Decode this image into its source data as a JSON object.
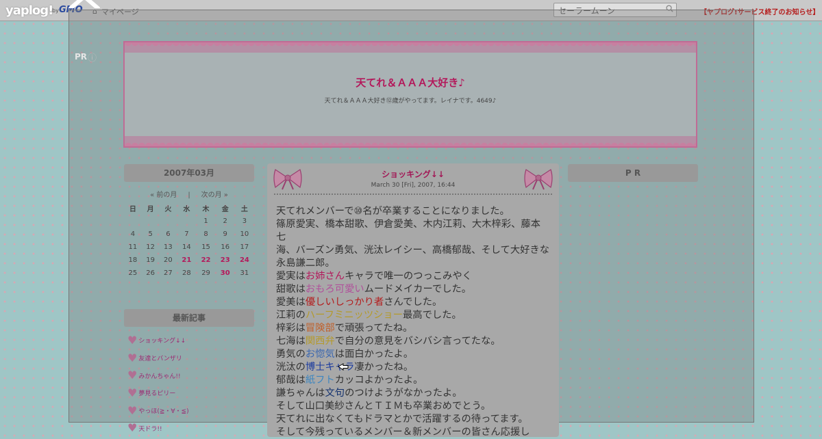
{
  "topbar": {
    "logo": "yaplog!",
    "logo_by": "by",
    "logo_gmo": "GMO",
    "mypage_label": "マイページ",
    "search_value": "セーラームーン",
    "notice": "【ヤプログ!サービス終了のお知らせ】"
  },
  "overlay": {
    "pr_label": "PR"
  },
  "blog": {
    "title": "天てれ＆ＡＡＡ大好き♪",
    "description": "天てれ＆ＡＡＡ大好き⑫歳がやってます。レイナです。4649♪"
  },
  "calendar": {
    "title": "2007年03月",
    "prev_label": "« 前の月",
    "separator": "|",
    "next_label": "次の月 »",
    "weekdays": [
      "日",
      "月",
      "火",
      "水",
      "木",
      "金",
      "土"
    ],
    "weeks": [
      [
        "",
        "",
        "",
        "",
        "1",
        "2",
        "3"
      ],
      [
        "4",
        "5",
        "6",
        "7",
        "8",
        "9",
        "10"
      ],
      [
        "11",
        "12",
        "13",
        "14",
        "15",
        "16",
        "17"
      ],
      [
        "18",
        "19",
        "20",
        "21",
        "22",
        "23",
        "24"
      ],
      [
        "25",
        "26",
        "27",
        "28",
        "29",
        "30",
        "31"
      ]
    ],
    "highlighted": [
      "21",
      "22",
      "23",
      "24",
      "30"
    ]
  },
  "recent": {
    "title": "最新記事",
    "items": [
      "ショッキング↓↓",
      "友達とバンザリ",
      "みかんちゃん!!",
      "夢見るピリー",
      "やっほ(≧・∀・≦)",
      "天ドラ!!"
    ]
  },
  "pr_right": "P R",
  "article": {
    "title": "ショッキング↓↓",
    "date": "March 30 [Fri], 2007, 16:44",
    "body": [
      [
        {
          "t": "天てれメンバーで⑩名が卒業することになりました。"
        }
      ],
      [
        {
          "t": "篠原愛実、橋本甜歌、伊倉愛美、木内江莉、大木梓彩、藤本七"
        }
      ],
      [
        {
          "t": "海、バーズン勇気、洸汰レイシー、高橋郁哉、そして大好きな"
        }
      ],
      [
        {
          "t": "永島謙二郎。"
        }
      ],
      [
        {
          "t": "愛実は"
        },
        {
          "t": "お姉さん",
          "c": "c1"
        },
        {
          "t": "キャラで唯一のつっこみやく"
        }
      ],
      [
        {
          "t": "甜歌は"
        },
        {
          "t": "おもろ可愛い",
          "c": "c2"
        },
        {
          "t": "ムードメイカーでした。"
        }
      ],
      [
        {
          "t": "愛美は"
        },
        {
          "t": "優しいしっかり者",
          "c": "c3"
        },
        {
          "t": "さんでした。"
        }
      ],
      [
        {
          "t": "江莉の"
        },
        {
          "t": "ハーフミニッツショー",
          "c": "c4"
        },
        {
          "t": "最高でした。"
        }
      ],
      [
        {
          "t": "梓彩は"
        },
        {
          "t": "冒険部",
          "c": "c5"
        },
        {
          "t": "で頑張ってたね。"
        }
      ],
      [
        {
          "t": "七海は"
        },
        {
          "t": "関西弁",
          "c": "c4"
        },
        {
          "t": "で自分の意見をバシバシ言ってたな。"
        }
      ],
      [
        {
          "t": "勇気の"
        },
        {
          "t": "お惚気",
          "c": "c6"
        },
        {
          "t": "は面白かったよ。"
        }
      ],
      [
        {
          "t": "洸汰の"
        },
        {
          "t": "博士キャラ",
          "c": "c7"
        },
        {
          "t": "凄かったね。"
        }
      ],
      [
        {
          "t": "郁哉は"
        },
        {
          "t": "紙フト",
          "c": "c8"
        },
        {
          "t": "カッコよかったよ。"
        }
      ],
      [
        {
          "t": "謙ちゃんは"
        },
        {
          "t": "文句",
          "c": "c9"
        },
        {
          "t": "のつけようがなかったよ。"
        }
      ],
      [
        {
          "t": "そして山口美紗さんとＴＩＭも卒業おめでとう。"
        }
      ],
      [
        {
          "t": "天てれに出なくてもドラマとかで活躍するの待ってます。"
        }
      ],
      [
        {
          "t": "そして今残っているメンバー＆新メンバーの皆さん応援し"
        }
      ]
    ]
  },
  "icons": {
    "close": "close-icon",
    "search": "search-icon",
    "home": "home-icon",
    "heart": "heart-icon",
    "bow": "bow-icon",
    "cursor": "cursor-icon"
  }
}
